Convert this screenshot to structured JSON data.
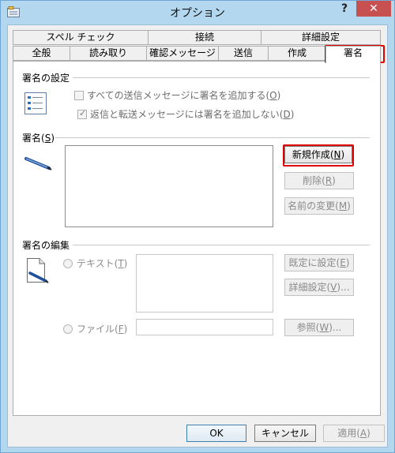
{
  "window": {
    "title": "オプション",
    "help_label": "?",
    "close_label": "✕"
  },
  "tabs_row1": [
    {
      "label": "スペル チェック"
    },
    {
      "label": "接続"
    },
    {
      "label": "詳細設定"
    }
  ],
  "tabs_row2": [
    {
      "label": "全般"
    },
    {
      "label": "読み取り"
    },
    {
      "label": "確認メッセージ"
    },
    {
      "label": "送信"
    },
    {
      "label": "作成"
    },
    {
      "label": "署名",
      "active": true
    }
  ],
  "signature_settings": {
    "heading": "署名の設定",
    "add_to_all": {
      "prefix": "すべての送信メッセージに署名を追加する(",
      "key": "O",
      "suffix": ")",
      "checked": false
    },
    "no_reply": {
      "prefix": "返信と転送メッセージには署名を追加しない(",
      "key": "D",
      "suffix": ")",
      "checked": true
    }
  },
  "signature": {
    "heading_prefix": "署名(",
    "heading_key": "S",
    "heading_suffix": ")",
    "new_button": {
      "prefix": "新規作成(",
      "key": "N",
      "suffix": ")"
    },
    "delete_button": {
      "prefix": "削除(",
      "key": "R",
      "suffix": ")"
    },
    "rename_button": {
      "prefix": "名前の変更(",
      "key": "M",
      "suffix": ")"
    }
  },
  "edit": {
    "heading": "署名の編集",
    "text_radio": {
      "prefix": "テキスト(",
      "key": "T",
      "suffix": ")"
    },
    "file_radio": {
      "prefix": "ファイル(",
      "key": "F",
      "suffix": ")"
    },
    "set_default_button": {
      "prefix": "既定に設定(",
      "key": "E",
      "suffix": ")"
    },
    "advanced_button": {
      "prefix": "詳細設定(",
      "key": "V",
      "suffix": ")..."
    },
    "browse_button": {
      "prefix": "参照(",
      "key": "W",
      "suffix": ")..."
    }
  },
  "footer": {
    "ok_label": "OK",
    "cancel_label": "キャンセル",
    "apply": {
      "prefix": "適用(",
      "key": "A",
      "suffix": ")"
    }
  },
  "colors": {
    "highlight": "#e00000",
    "window_frame": "#b4d7f0",
    "close_button": "#c75050"
  }
}
